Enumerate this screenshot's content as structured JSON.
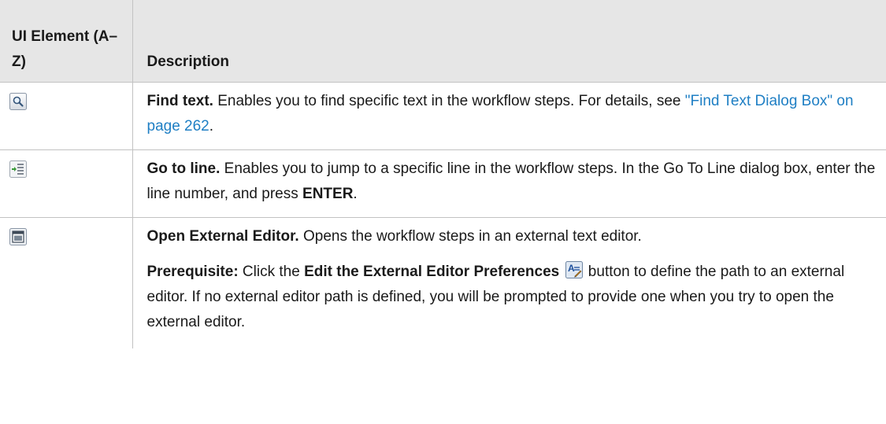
{
  "table": {
    "header": {
      "col1": "UI Element (A–Z)",
      "col2": "Description"
    },
    "rows": [
      {
        "icon": "find-text-icon",
        "title": "Find text.",
        "text": " Enables you to find specific text in the workflow steps. For details, see ",
        "link": "\"Find Text Dialog Box\" on page 262",
        "tail": "."
      },
      {
        "icon": "go-to-line-icon",
        "title": "Go to line.",
        "text": " Enables you to jump to a specific line in the workflow steps. In the Go To Line dialog box, enter the line number, and press ",
        "key": "ENTER",
        "tail": "."
      },
      {
        "icon": "open-external-editor-icon",
        "title": "Open External Editor.",
        "text": " Opens the workflow steps in an external text editor.",
        "prereq_label": "Prerequisite:",
        "prereq_pre": " Click the ",
        "prereq_bold": "Edit the External Editor Preferences",
        "prereq_icon": "edit-preferences-icon",
        "prereq_post": " button to define the path to an external editor. If no external editor path is defined, you will be prompted to provide one when you try to open the external editor."
      }
    ]
  }
}
